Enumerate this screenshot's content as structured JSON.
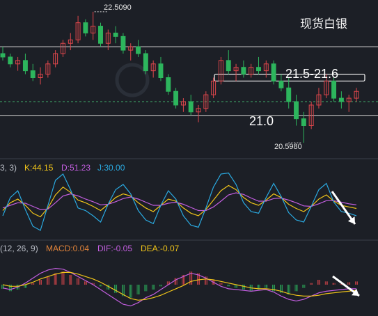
{
  "title": "现货白银",
  "colors": {
    "background": "#1c1f26",
    "up": "#e0474c",
    "down": "#2db55d",
    "k_line": "#f0c419",
    "d_line": "#c35ee0",
    "j_line": "#2aa9e0",
    "macd_bar_up": "#e0474c",
    "macd_bar_down": "#2db55d",
    "dif_line": "#c35ee0",
    "dea_line": "#f0c419",
    "panel_border": "#3a3f4a",
    "dashed_guide": "#3fae6b",
    "level_line": "#ffffff"
  },
  "chart_data": [
    {
      "type": "candlestick",
      "title": "现货白银",
      "annotations": {
        "high_label": "22.5090",
        "low_label": "20.5980",
        "resistance_label": "21.5-21.6",
        "support_label": "21.0"
      },
      "levels": {
        "upper_line": 22.0,
        "resistance_box": [
          21.5,
          21.6
        ],
        "support_line": 21.0,
        "mid_dashed": 21.2
      },
      "ylim": [
        20.5,
        22.6
      ],
      "candles": [
        [
          21.9,
          22.0,
          21.8,
          21.85
        ],
        [
          21.85,
          21.9,
          21.7,
          21.75
        ],
        [
          21.75,
          21.85,
          21.65,
          21.8
        ],
        [
          21.8,
          21.9,
          21.6,
          21.65
        ],
        [
          21.65,
          21.75,
          21.5,
          21.55
        ],
        [
          21.55,
          21.7,
          21.45,
          21.6
        ],
        [
          21.6,
          21.8,
          21.55,
          21.75
        ],
        [
          21.75,
          21.95,
          21.7,
          21.9
        ],
        [
          21.9,
          22.1,
          21.85,
          22.05
        ],
        [
          22.05,
          22.2,
          21.95,
          22.1
        ],
        [
          22.1,
          22.45,
          22.05,
          22.35
        ],
        [
          22.35,
          22.4,
          22.15,
          22.2
        ],
        [
          22.2,
          22.51,
          22.1,
          22.3
        ],
        [
          22.3,
          22.35,
          22.0,
          22.05
        ],
        [
          22.05,
          22.25,
          21.95,
          22.2
        ],
        [
          22.2,
          22.3,
          22.05,
          22.15
        ],
        [
          22.15,
          22.2,
          21.9,
          21.95
        ],
        [
          21.95,
          22.05,
          21.8,
          22.0
        ],
        [
          22.0,
          22.1,
          21.85,
          21.9
        ],
        [
          21.9,
          21.95,
          21.6,
          21.65
        ],
        [
          21.65,
          21.8,
          21.55,
          21.75
        ],
        [
          21.75,
          21.85,
          21.5,
          21.55
        ],
        [
          21.55,
          21.6,
          21.3,
          21.35
        ],
        [
          21.35,
          21.4,
          21.1,
          21.15
        ],
        [
          21.15,
          21.25,
          21.05,
          21.2
        ],
        [
          21.2,
          21.3,
          21.0,
          21.05
        ],
        [
          21.05,
          21.15,
          20.9,
          21.1
        ],
        [
          21.1,
          21.35,
          21.05,
          21.3
        ],
        [
          21.3,
          21.55,
          21.25,
          21.5
        ],
        [
          21.5,
          21.85,
          21.45,
          21.8
        ],
        [
          21.8,
          21.95,
          21.6,
          21.65
        ],
        [
          21.65,
          21.75,
          21.5,
          21.7
        ],
        [
          21.7,
          21.8,
          21.55,
          21.6
        ],
        [
          21.6,
          21.75,
          21.55,
          21.7
        ],
        [
          21.7,
          21.85,
          21.6,
          21.65
        ],
        [
          21.65,
          21.8,
          21.55,
          21.75
        ],
        [
          21.75,
          21.8,
          21.45,
          21.5
        ],
        [
          21.5,
          21.6,
          21.35,
          21.4
        ],
        [
          21.4,
          21.55,
          21.1,
          21.2
        ],
        [
          21.2,
          21.3,
          20.85,
          20.95
        ],
        [
          20.95,
          21.05,
          20.6,
          20.85
        ],
        [
          20.85,
          21.2,
          20.8,
          21.15
        ],
        [
          21.15,
          21.4,
          21.1,
          21.3
        ],
        [
          21.3,
          21.6,
          21.25,
          21.5
        ],
        [
          21.5,
          21.55,
          21.2,
          21.25
        ],
        [
          21.25,
          21.35,
          21.1,
          21.2
        ],
        [
          21.2,
          21.3,
          21.05,
          21.25
        ],
        [
          21.25,
          21.4,
          21.2,
          21.35
        ]
      ]
    },
    {
      "type": "line",
      "indicator": "KDJ",
      "params_label": "3, 3)",
      "labels": {
        "k": "K:44.15",
        "d": "D:51.23",
        "j": "J:30.00"
      },
      "ylim": [
        -10,
        110
      ],
      "series": [
        {
          "name": "K",
          "values": [
            40,
            55,
            62,
            50,
            35,
            28,
            45,
            70,
            85,
            75,
            60,
            55,
            48,
            40,
            52,
            65,
            72,
            68,
            55,
            45,
            38,
            50,
            62,
            58,
            45,
            35,
            30,
            42,
            60,
            78,
            88,
            80,
            65,
            55,
            50,
            60,
            72,
            65,
            52,
            44,
            38,
            48,
            62,
            70,
            58,
            50,
            47,
            44
          ]
        },
        {
          "name": "D",
          "values": [
            45,
            50,
            55,
            54,
            48,
            42,
            43,
            55,
            68,
            72,
            68,
            62,
            57,
            51,
            52,
            57,
            63,
            66,
            62,
            56,
            50,
            50,
            54,
            56,
            52,
            46,
            40,
            40,
            47,
            58,
            70,
            74,
            71,
            64,
            58,
            58,
            63,
            64,
            60,
            55,
            49,
            48,
            53,
            59,
            59,
            56,
            53,
            51
          ]
        },
        {
          "name": "J",
          "values": [
            30,
            65,
            78,
            42,
            10,
            2,
            50,
            98,
            110,
            80,
            45,
            40,
            30,
            18,
            52,
            80,
            90,
            72,
            40,
            22,
            15,
            50,
            78,
            62,
            30,
            12,
            8,
            45,
            85,
            110,
            112,
            90,
            55,
            38,
            35,
            65,
            92,
            67,
            36,
            22,
            18,
            48,
            80,
            92,
            56,
            38,
            35,
            30
          ]
        }
      ]
    },
    {
      "type": "bar",
      "indicator": "MACD",
      "params_label": "(12, 26, 9)",
      "labels": {
        "macd": "MACD:0.04",
        "dif": "DIF:-0.05",
        "dea": "DEA:-0.07"
      },
      "ylim": [
        -0.35,
        0.35
      ],
      "series": [
        {
          "name": "MACD",
          "values": [
            -0.05,
            -0.08,
            -0.06,
            -0.04,
            0.02,
            0.06,
            0.1,
            0.14,
            0.16,
            0.12,
            0.08,
            0.04,
            0.02,
            -0.02,
            -0.06,
            -0.1,
            -0.14,
            -0.16,
            -0.12,
            -0.08,
            -0.06,
            -0.02,
            0.04,
            0.08,
            0.12,
            0.16,
            0.14,
            0.1,
            0.06,
            0.02,
            -0.02,
            -0.04,
            -0.06,
            -0.08,
            -0.06,
            -0.04,
            -0.08,
            -0.1,
            -0.12,
            -0.08,
            -0.04,
            0.02,
            0.06,
            0.04,
            0.02,
            0.01,
            0.03,
            0.04
          ]
        },
        {
          "name": "DIF",
          "values": [
            -0.04,
            -0.06,
            -0.03,
            0.02,
            0.08,
            0.14,
            0.18,
            0.2,
            0.19,
            0.15,
            0.1,
            0.05,
            0.0,
            -0.06,
            -0.12,
            -0.18,
            -0.24,
            -0.26,
            -0.22,
            -0.16,
            -0.12,
            -0.06,
            0.0,
            0.06,
            0.1,
            0.14,
            0.12,
            0.08,
            0.03,
            -0.02,
            -0.05,
            -0.06,
            -0.07,
            -0.08,
            -0.07,
            -0.06,
            -0.09,
            -0.14,
            -0.18,
            -0.2,
            -0.18,
            -0.14,
            -0.1,
            -0.08,
            -0.07,
            -0.06,
            -0.05,
            -0.05
          ]
        },
        {
          "name": "DEA",
          "values": [
            0.0,
            -0.02,
            -0.02,
            0.0,
            0.03,
            0.07,
            0.1,
            0.13,
            0.15,
            0.15,
            0.13,
            0.1,
            0.07,
            0.03,
            -0.02,
            -0.07,
            -0.12,
            -0.17,
            -0.19,
            -0.18,
            -0.16,
            -0.13,
            -0.09,
            -0.05,
            -0.01,
            0.04,
            0.06,
            0.07,
            0.06,
            0.04,
            0.02,
            0.0,
            -0.02,
            -0.04,
            -0.05,
            -0.05,
            -0.06,
            -0.08,
            -0.11,
            -0.13,
            -0.14,
            -0.14,
            -0.13,
            -0.11,
            -0.1,
            -0.09,
            -0.08,
            -0.07
          ]
        }
      ]
    }
  ]
}
